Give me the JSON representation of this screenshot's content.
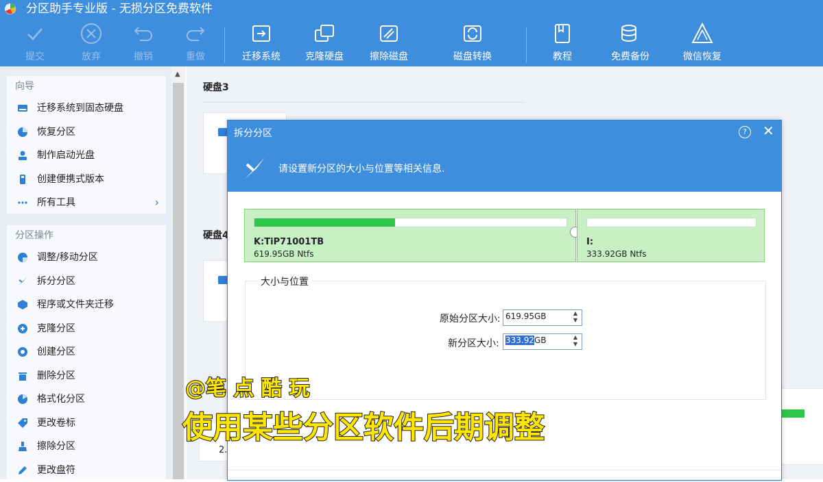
{
  "app": {
    "title": "分区助手专业版 - 无损分区免费软件"
  },
  "toolbar": {
    "buttons": [
      {
        "label": "提交",
        "icon": "check-icon"
      },
      {
        "label": "放弃",
        "icon": "cancel-icon"
      },
      {
        "label": "撤销",
        "icon": "undo-icon"
      },
      {
        "label": "重做",
        "icon": "redo-icon"
      },
      {
        "label": "迁移系统",
        "icon": "migrate-os-icon"
      },
      {
        "label": "克隆硬盘",
        "icon": "clone-disk-icon"
      },
      {
        "label": "擦除磁盘",
        "icon": "wipe-disk-icon"
      },
      {
        "label": "磁盘转换",
        "icon": "disk-convert-icon"
      },
      {
        "label": "教程",
        "icon": "tutorial-icon"
      },
      {
        "label": "免费备份",
        "icon": "backup-icon"
      },
      {
        "label": "微信恢复",
        "icon": "wechat-recover-icon"
      }
    ]
  },
  "sidebar": {
    "wizard": {
      "header": "向导",
      "items": [
        {
          "label": "迁移系统到固态硬盘",
          "icon": "ssd-icon"
        },
        {
          "label": "恢复分区",
          "icon": "pie-icon"
        },
        {
          "label": "制作启动光盘",
          "icon": "boot-disc-icon"
        },
        {
          "label": "创建便携式版本",
          "icon": "usb-icon"
        },
        {
          "label": "所有工具",
          "icon": "more-icon",
          "chevron": "›"
        }
      ]
    },
    "ops": {
      "header": "分区操作",
      "items": [
        {
          "label": "调整/移动分区",
          "icon": "resize-icon"
        },
        {
          "label": "拆分分区",
          "icon": "split-icon"
        },
        {
          "label": "程序或文件夹迁移",
          "icon": "app-move-icon"
        },
        {
          "label": "克隆分区",
          "icon": "clone-partition-icon"
        },
        {
          "label": "创建分区",
          "icon": "create-partition-icon"
        },
        {
          "label": "删除分区",
          "icon": "delete-partition-icon"
        },
        {
          "label": "格式化分区",
          "icon": "format-icon"
        },
        {
          "label": "更改卷标",
          "icon": "tag-icon"
        },
        {
          "label": "擦除分区",
          "icon": "wipe-partition-icon"
        },
        {
          "label": "更改盘符",
          "icon": "pen-icon"
        }
      ]
    }
  },
  "main": {
    "disk3_label": "硬盘3",
    "disk4_label": "硬盘4",
    "row_number": "2."
  },
  "dialog": {
    "title": "拆分分区",
    "help": "?",
    "close": "✕",
    "message": "请设置新分区的大小与位置等相关信息.",
    "partitions": [
      {
        "name": "K:TiP71001TB",
        "size": "619.95GB Ntfs",
        "usage": 0.45
      },
      {
        "name": "I:",
        "size": "333.92GB Ntfs",
        "usage": 0.0
      }
    ],
    "group_title": "大小与位置",
    "original_size_label": "原始分区大小:",
    "original_size_value": "619.95GB",
    "new_size_label": "新分区大小:",
    "new_size_selected": "333.92",
    "new_size_unit": "GB"
  },
  "overlay": {
    "watermark": "@笔 点 酷 玩",
    "caption": "使用某些分区软件后期调整"
  }
}
